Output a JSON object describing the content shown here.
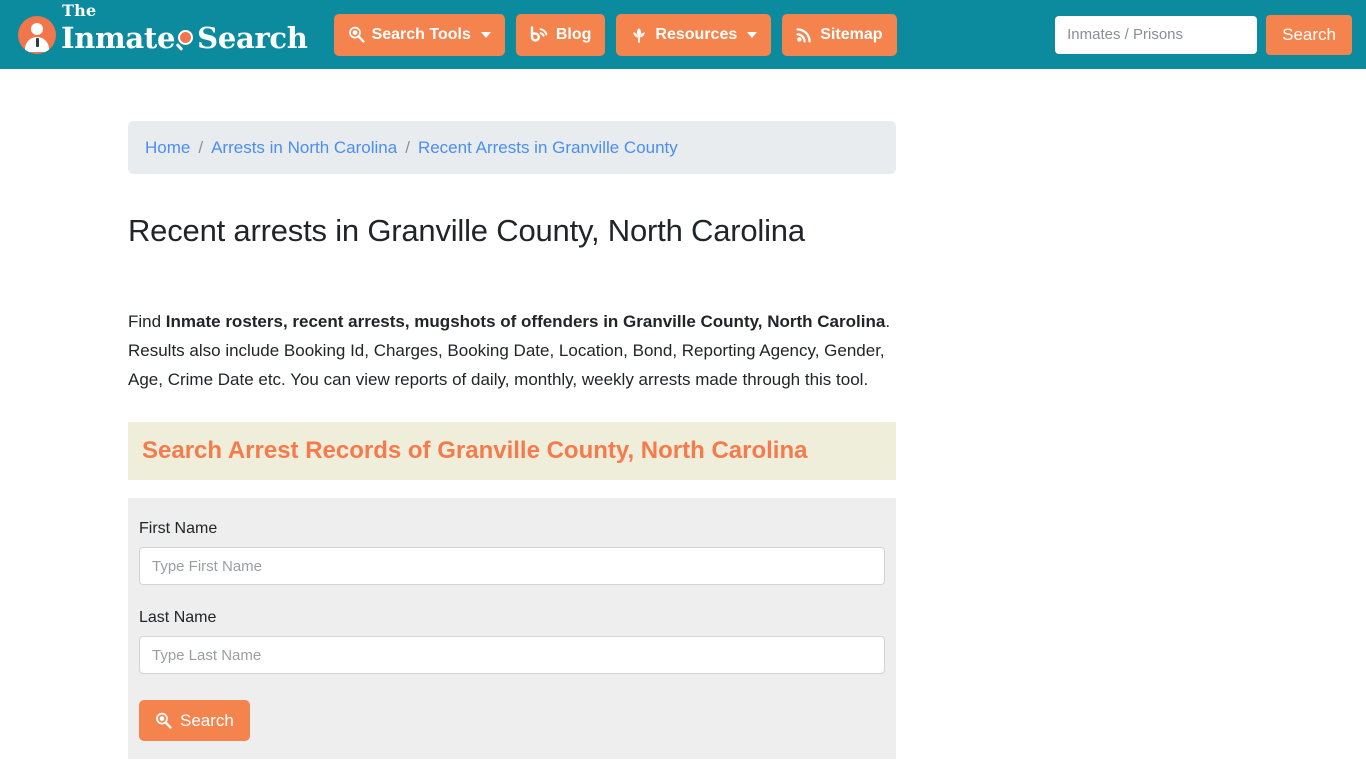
{
  "header": {
    "brand": {
      "the": "The",
      "word1": "Inmate",
      "word2": "Search"
    },
    "nav": [
      {
        "label": "Search Tools",
        "icon": "search-clock-icon",
        "caret": true
      },
      {
        "label": "Blog",
        "icon": "blog-rss-icon",
        "caret": false
      },
      {
        "label": "Resources",
        "icon": "leaf-icon",
        "caret": true
      },
      {
        "label": "Sitemap",
        "icon": "rss-icon",
        "caret": false
      }
    ],
    "search": {
      "placeholder": "Inmates / Prisons",
      "value": "",
      "button_label": "Search"
    }
  },
  "breadcrumb": {
    "items": [
      {
        "label": "Home"
      },
      {
        "label": "Arrests in North Carolina"
      },
      {
        "label": "Recent Arrests in Granville County"
      }
    ],
    "separator": "/"
  },
  "main": {
    "page_title": "Recent arrests in Granville County, North Carolina",
    "intro": {
      "lead": "Find ",
      "bold": "Inmate rosters, recent arrests, mugshots of offenders in Granville County, North Carolina",
      "rest": ". Results also include Booking Id, Charges, Booking Date, Location, Bond, Reporting Agency, Gender, Age, Crime Date etc. You can view reports of daily, monthly, weekly arrests made through this tool."
    },
    "highlight_heading": "Search Arrest Records of Granville County, North Carolina",
    "form": {
      "fields": [
        {
          "label": "First Name",
          "placeholder": "Type First Name",
          "value": ""
        },
        {
          "label": "Last Name",
          "placeholder": "Type Last Name",
          "value": ""
        }
      ],
      "submit_label": "Search",
      "submit_icon": "search-clock-icon"
    }
  },
  "colors": {
    "header_teal": "#0d8b9e",
    "accent_orange": "#f5834d",
    "breadcrumb_bg": "#e9ecef",
    "highlight_bg": "#eeeedb",
    "highlight_text": "#f57b4d",
    "form_bg": "#eeeeee",
    "link_blue": "#4b8ef1"
  }
}
